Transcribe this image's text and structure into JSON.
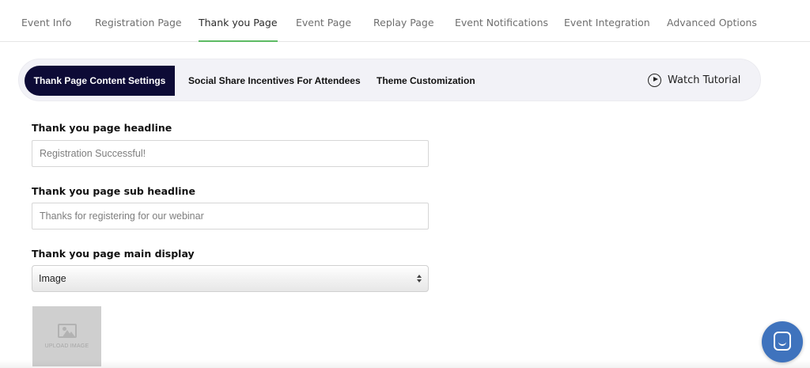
{
  "top_tabs": [
    {
      "label": "Event Info"
    },
    {
      "label": "Registration Page"
    },
    {
      "label": "Thank you Page",
      "active": true
    },
    {
      "label": "Event Page"
    },
    {
      "label": "Replay Page"
    },
    {
      "label": "Event Notifications"
    },
    {
      "label": "Event Integration"
    },
    {
      "label": "Advanced Options"
    }
  ],
  "sub_tabs": [
    {
      "label": "Thank Page Content Settings",
      "active": true
    },
    {
      "label": "Social Share Incentives For Attendees"
    },
    {
      "label": "Theme Customization"
    }
  ],
  "watch_tutorial": {
    "label": "Watch Tutorial",
    "icon": "play-circle-icon"
  },
  "form": {
    "headline": {
      "label": "Thank you page headline",
      "placeholder": "Registration Successful!"
    },
    "sub_headline": {
      "label": "Thank you page sub headline",
      "placeholder": "Thanks for registering for our webinar"
    },
    "main_display": {
      "label": "Thank you page main display",
      "value": "Image"
    },
    "upload": {
      "label": "UPLOAD IMAGE",
      "icon": "image-icon"
    }
  },
  "chat": {
    "icon": "chat-icon"
  },
  "colors": {
    "active_tab_underline": "#5dbb63",
    "active_pill": "#0d0b36",
    "subnav_bg": "#f2f2f7",
    "chat_bubble": "#3f73bd"
  }
}
